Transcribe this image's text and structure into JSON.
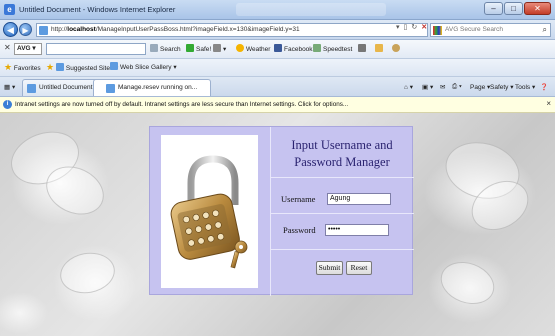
{
  "window": {
    "title": "Untitled Document - Windows Internet Explorer",
    "controls": [
      "–",
      "□",
      "✕"
    ]
  },
  "address_bar": {
    "url_prefix": "http://",
    "url_host": "localhost",
    "url_rest": "/ManageInputUserPassBoss.html?imageField.x=130&imageField.y=31",
    "search_placeholder": "AVG Secure Search"
  },
  "toolbar": {
    "avg_label": "AVG",
    "search_label": "Search",
    "safe_label": "Safe!",
    "weather_label": "Weather",
    "facebook_label": "Facebook",
    "speedtest_label": "Speedtest"
  },
  "favorites_bar": {
    "favorites_label": "Favorites",
    "suggested_label": "Suggested Sites ▾",
    "webslice_label": "Web Slice Gallery ▾"
  },
  "tabs": [
    {
      "label": "Untitled Document"
    },
    {
      "label": "Manage.resev running on..."
    }
  ],
  "command_bar": {
    "page_label": "Page ▾",
    "safety_label": "Safety ▾",
    "tools_label": "Tools ▾"
  },
  "info_bar": {
    "message": "Intranet settings are now turned off by default. Intranet settings are less secure than Internet settings. Click for options..."
  },
  "login_form": {
    "title": "Input Username and Password Manager",
    "username_label": "Username",
    "username_value": "Agung",
    "password_label": "Password",
    "password_value": "•••••",
    "submit_label": "Submit",
    "reset_label": "Reset"
  },
  "colors": {
    "panel_background": "#c6c3f0",
    "title_text": "#2a2370",
    "info_bar": "#ffffe1"
  }
}
